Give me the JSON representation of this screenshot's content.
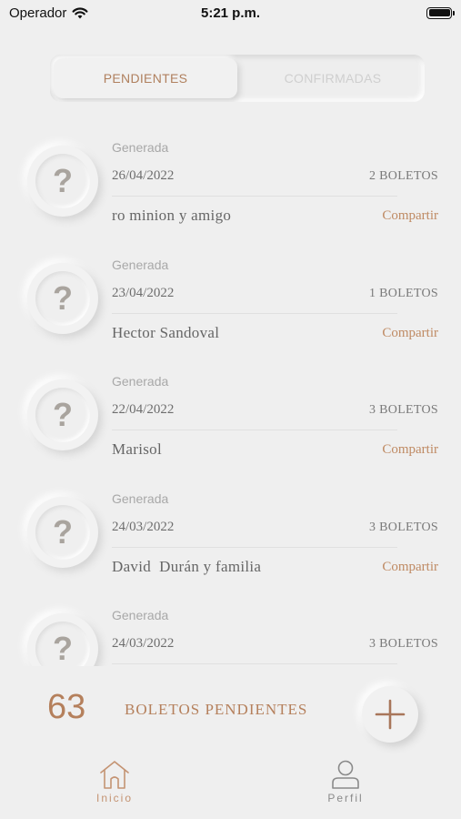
{
  "status_bar": {
    "carrier": "Operador",
    "time": "5:21 p.m."
  },
  "tabs": {
    "pending": "PENDIENTES",
    "confirmed": "CONFIRMADAS"
  },
  "tickets": [
    {
      "status": "Generada",
      "date": "26/04/2022",
      "count": "2 BOLETOS",
      "name": "ro minion y amigo",
      "action": "Compartir",
      "avatar": "?"
    },
    {
      "status": "Generada",
      "date": "23/04/2022",
      "count": "1 BOLETOS",
      "name": "Hector Sandoval",
      "action": "Compartir",
      "avatar": "?"
    },
    {
      "status": "Generada",
      "date": "22/04/2022",
      "count": "3 BOLETOS",
      "name": "Marisol",
      "action": "Compartir",
      "avatar": "?"
    },
    {
      "status": "Generada",
      "date": "24/03/2022",
      "count": "3 BOLETOS",
      "name": "David  Durán y familia",
      "action": "Compartir",
      "avatar": "?"
    },
    {
      "status": "Generada",
      "date": "24/03/2022",
      "count": "3 BOLETOS",
      "name": "",
      "action": "",
      "avatar": "?"
    }
  ],
  "summary": {
    "count": "63",
    "label": "BOLETOS PENDIENTES"
  },
  "tabbar": {
    "home": "Inicio",
    "profile": "Perfil"
  },
  "colors": {
    "accent": "#bf8a63",
    "background": "#efefef"
  }
}
